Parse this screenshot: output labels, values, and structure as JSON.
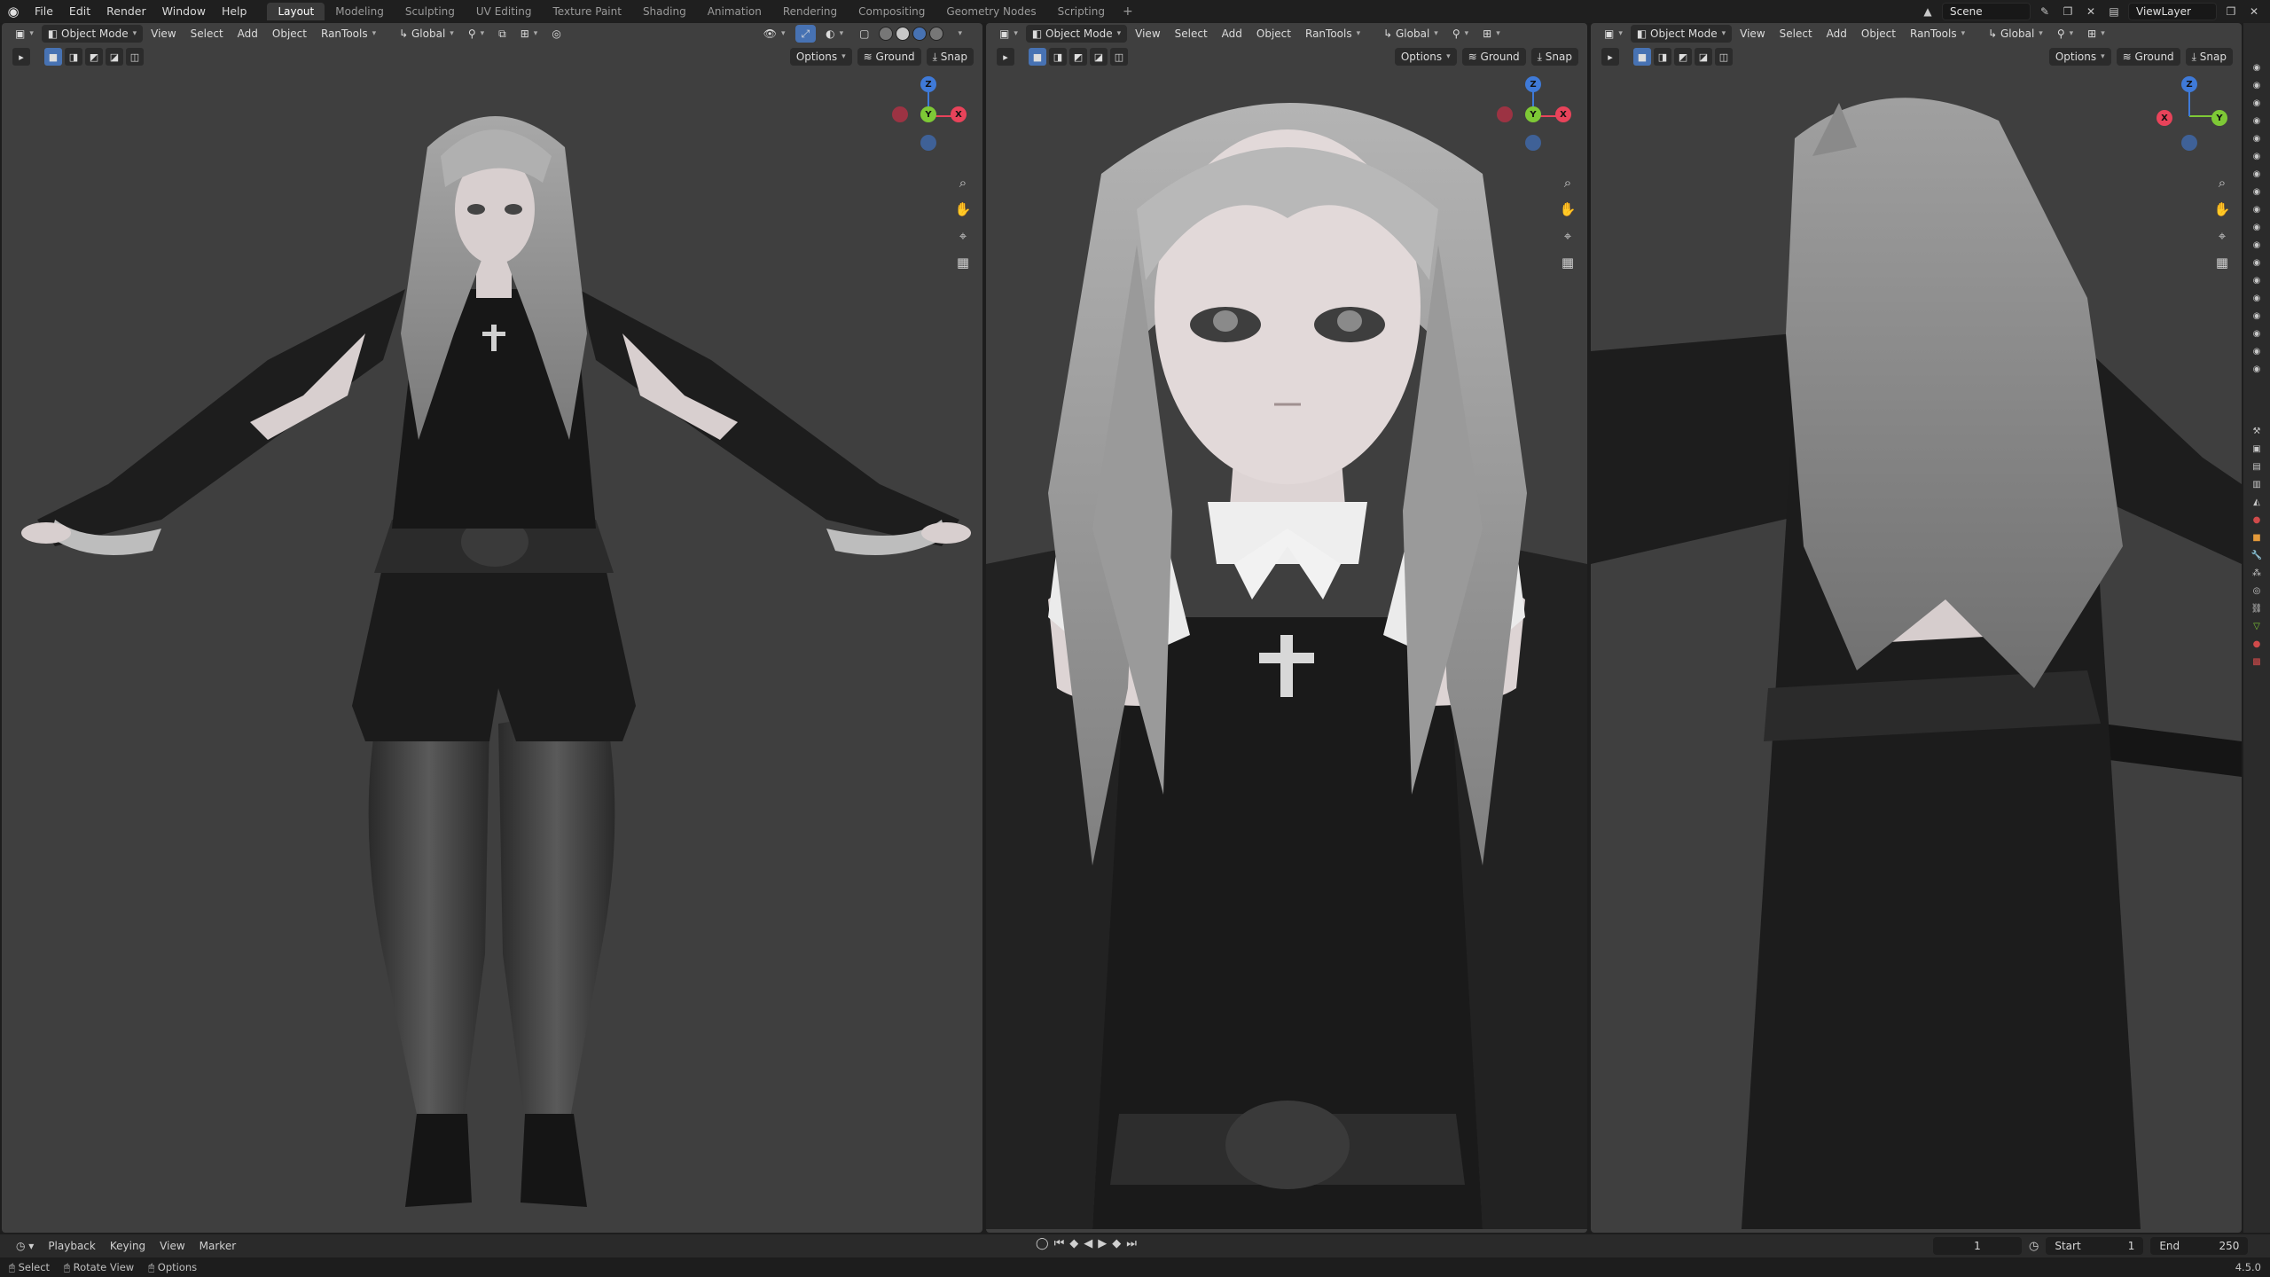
{
  "topbar": {
    "menus": [
      "File",
      "Edit",
      "Render",
      "Window",
      "Help"
    ],
    "workspaces": [
      "Layout",
      "Modeling",
      "Sculpting",
      "UV Editing",
      "Texture Paint",
      "Shading",
      "Animation",
      "Rendering",
      "Compositing",
      "Geometry Nodes",
      "Scripting"
    ],
    "active_workspace": "Layout",
    "scene": "Scene",
    "view_layer": "ViewLayer"
  },
  "viewports": [
    {
      "mode": "Object Mode",
      "menus": [
        "View",
        "Select",
        "Add",
        "Object",
        "RanTools"
      ],
      "orientation": "Global",
      "options": "Options",
      "ground": "Ground",
      "snap": "Snap"
    },
    {
      "mode": "Object Mode",
      "menus": [
        "View",
        "Select",
        "Add",
        "Object",
        "RanTools"
      ],
      "orientation": "Global",
      "options": "Options",
      "ground": "Ground",
      "snap": "Snap"
    },
    {
      "mode": "Object Mode",
      "menus": [
        "View",
        "Select",
        "Add",
        "Object",
        "RanTools"
      ],
      "orientation": "Global",
      "options": "Options",
      "ground": "Ground",
      "snap": "Snap"
    }
  ],
  "gizmo": {
    "x": "X",
    "y": "Y",
    "z": "Z"
  },
  "timeline": {
    "menus": [
      "Playback",
      "Keying",
      "View",
      "Marker"
    ],
    "current_frame": "1",
    "start_label": "Start",
    "start": "1",
    "end_label": "End",
    "end": "250"
  },
  "statusbar": {
    "select": "Select",
    "rotate": "Rotate View",
    "options": "Options",
    "version": "4.5.0"
  },
  "colors": {
    "accent": "#4772b3",
    "axis_x": "#e8435a",
    "axis_y": "#7ec936",
    "axis_z": "#3f7ad8",
    "viewport_bg": "#3f3f3f"
  }
}
